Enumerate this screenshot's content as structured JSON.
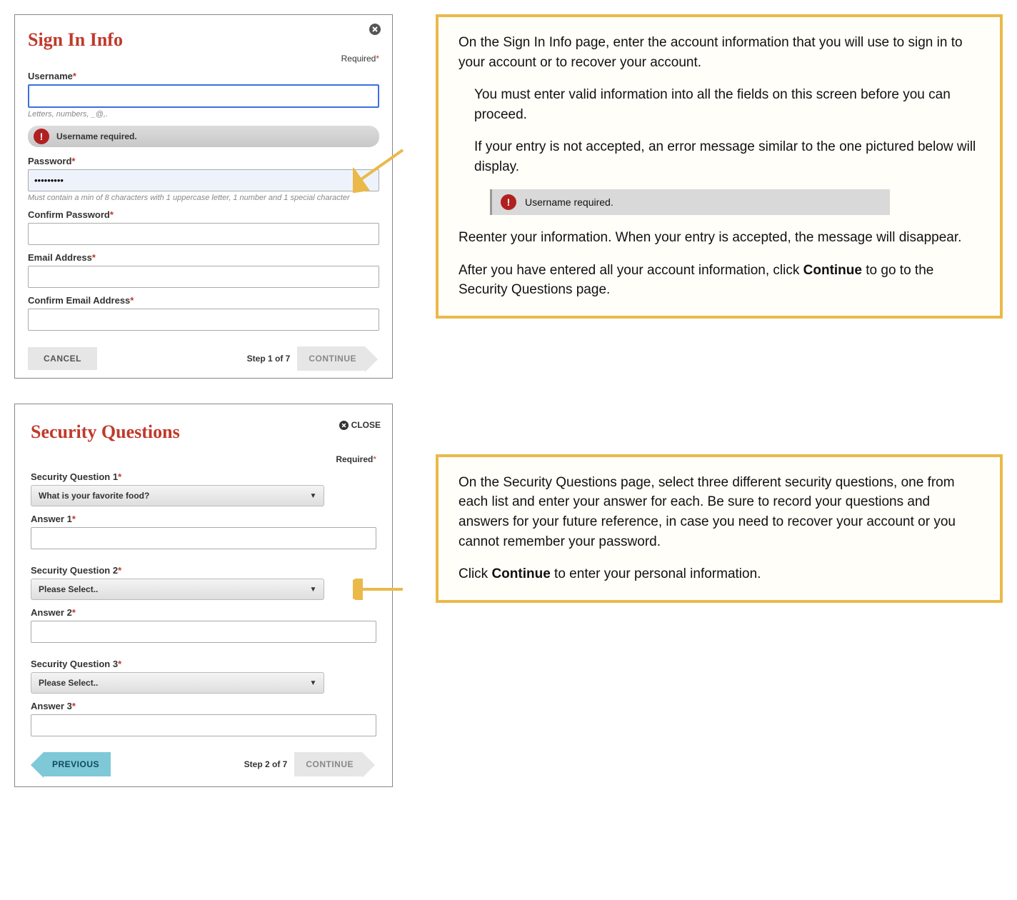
{
  "signin": {
    "title": "Sign In Info",
    "required_label": "Required",
    "username_label": "Username",
    "username_hint": "Letters, numbers, _@,.",
    "username_error": "Username required.",
    "password_label": "Password",
    "password_value": "•••••••••",
    "password_hint": "Must contain a min of 8 characters with 1 uppercase letter, 1 number and 1 special character",
    "confirm_password_label": "Confirm Password",
    "email_label": "Email Address",
    "confirm_email_label": "Confirm Email Address",
    "cancel": "CANCEL",
    "step": "Step 1 of 7",
    "continue": "CONTINUE"
  },
  "security": {
    "title": "Security Questions",
    "close_label": "CLOSE",
    "required_label": "Required",
    "q1_label": "Security Question 1",
    "q1_value": "What is your favorite food?",
    "a1_label": "Answer 1",
    "q2_label": "Security Question 2",
    "q2_value": "Please Select..",
    "a2_label": "Answer 2",
    "q3_label": "Security Question 3",
    "q3_value": "Please Select..",
    "a3_label": "Answer 3",
    "previous": "PREVIOUS",
    "step": "Step 2 of 7",
    "continue": "CONTINUE"
  },
  "callout1": {
    "p1": "On the Sign In Info page, enter the account information that you will use to sign in to your account or to recover your account.",
    "p2": "You must enter valid information into all the fields on this screen before you can proceed.",
    "p3": "If your entry is not accepted, an error message similar to the one pictured below will display.",
    "error_sample": "Username required.",
    "p4": "Reenter your information. When your entry is accepted, the message will disappear.",
    "p5a": "After you have entered all your account information, click ",
    "p5b": "Continue",
    "p5c": " to go to the Security Questions page."
  },
  "callout2": {
    "p1": "On the Security Questions page, select three different security questions, one from each list and enter your answer for each. Be sure to record your questions and answers for your future reference, in case you need to recover your account or you cannot remember your password.",
    "p2a": "Click ",
    "p2b": "Continue",
    "p2c": " to enter your personal information."
  }
}
